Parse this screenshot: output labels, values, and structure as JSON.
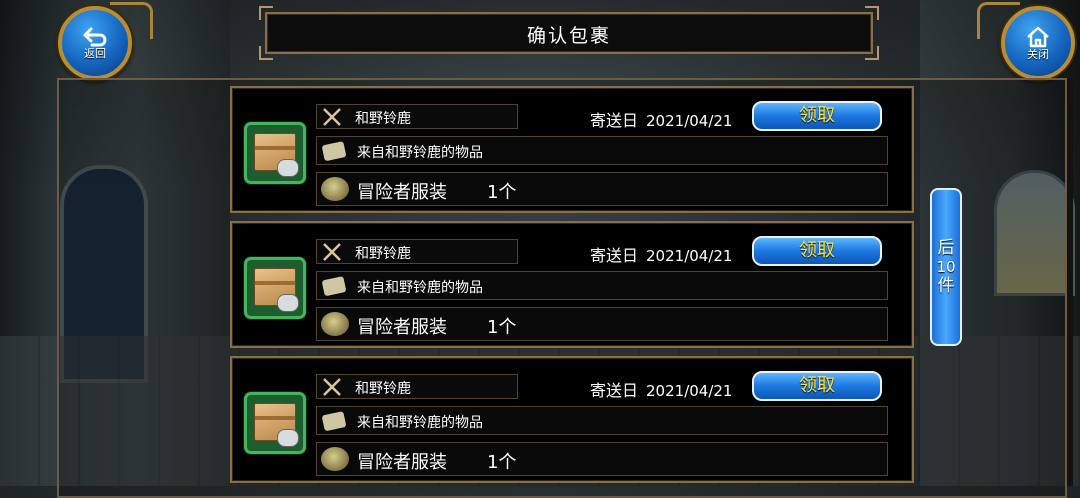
{
  "header": {
    "title": "确认包裹",
    "back_label": "返回",
    "close_label": "关闭"
  },
  "parcels": [
    {
      "sender": "和野铃鹿",
      "date_label": "寄送日",
      "date": "2021/04/21",
      "claim_label": "领取",
      "message": "来自和野铃鹿的物品",
      "item_name": "冒险者服装",
      "item_qty": "1个"
    },
    {
      "sender": "和野铃鹿",
      "date_label": "寄送日",
      "date": "2021/04/21",
      "claim_label": "领取",
      "message": "来自和野铃鹿的物品",
      "item_name": "冒险者服装",
      "item_qty": "1个"
    },
    {
      "sender": "和野铃鹿",
      "date_label": "寄送日",
      "date": "2021/04/21",
      "claim_label": "领取",
      "message": "来自和野铃鹿的物品",
      "item_name": "冒险者服装",
      "item_qty": "1个"
    }
  ],
  "pager": {
    "next_char": "后",
    "next_count": "10",
    "next_unit": "件"
  },
  "colors": {
    "accent_blue": "#1d78e0",
    "claim_text": "#ffe33c",
    "frame_gold": "#8a6e48",
    "package_green": "#46b35e"
  },
  "icons": {
    "back": "back-arrow-icon",
    "close": "home-icon",
    "sender": "crossed-swords-icon",
    "message": "scroll-icon",
    "item": "costume-icon",
    "package": "package-box-icon"
  }
}
